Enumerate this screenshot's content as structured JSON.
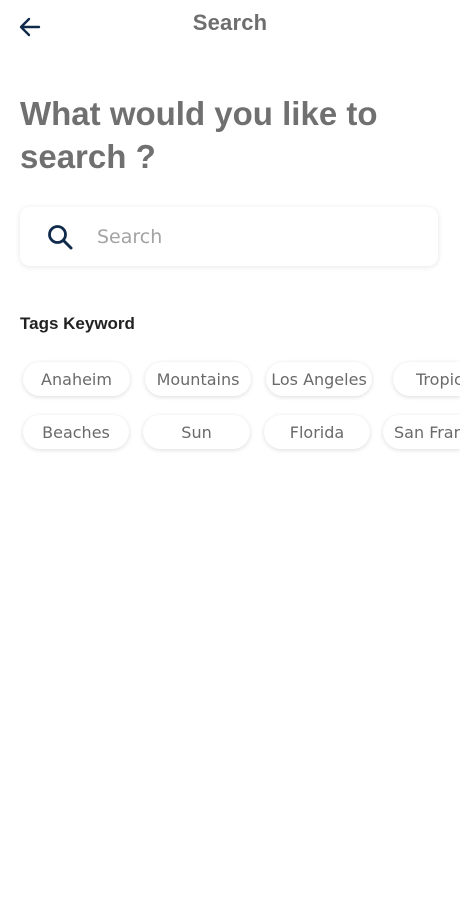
{
  "header": {
    "title": "Search",
    "back_icon": "arrow-left-icon"
  },
  "headline": "What would you like to search ?",
  "search": {
    "placeholder": "Search",
    "value": "",
    "icon": "search-icon"
  },
  "tags": {
    "title": "Tags Keyword",
    "row1": [
      "Anaheim",
      "Mountains",
      "Los Angeles",
      "Tropic"
    ],
    "row2": [
      "Beaches",
      "Sun",
      "Florida",
      "San Fran"
    ]
  },
  "colors": {
    "icon_navy": "#0f2a4a",
    "title_gray": "#6e6e6e",
    "tag_text": "#6a6a6a"
  }
}
